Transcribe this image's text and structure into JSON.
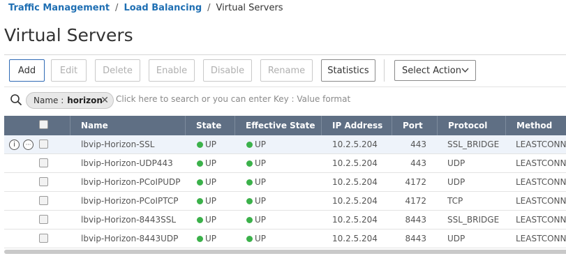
{
  "breadcrumb": {
    "items": [
      "Traffic Management",
      "Load Balancing"
    ],
    "current": "Virtual Servers",
    "separator": "/"
  },
  "page_title": "Virtual Servers",
  "toolbar": {
    "add": "Add",
    "edit": "Edit",
    "delete": "Delete",
    "enable": "Enable",
    "disable": "Disable",
    "rename": "Rename",
    "statistics": "Statistics",
    "select_action": "Select Action"
  },
  "search": {
    "chip_key": "Name :",
    "chip_value": "horizon",
    "placeholder": "Click here to search or you can enter Key : Value format"
  },
  "table": {
    "columns": [
      "Name",
      "State",
      "Effective State",
      "IP Address",
      "Port",
      "Protocol",
      "Method"
    ],
    "rows": [
      {
        "name": "lbvip-Horizon-SSL",
        "state": "UP",
        "effective_state": "UP",
        "ip": "10.2.5.204",
        "port": "443",
        "protocol": "SSL_BRIDGE",
        "method": "LEASTCONNE"
      },
      {
        "name": "lbvip-Horizon-UDP443",
        "state": "UP",
        "effective_state": "UP",
        "ip": "10.2.5.204",
        "port": "443",
        "protocol": "UDP",
        "method": "LEASTCONNE"
      },
      {
        "name": "lbvip-Horizon-PCoIPUDP",
        "state": "UP",
        "effective_state": "UP",
        "ip": "10.2.5.204",
        "port": "4172",
        "protocol": "UDP",
        "method": "LEASTCONNE"
      },
      {
        "name": "lbvip-Horizon-PCoIPTCP",
        "state": "UP",
        "effective_state": "UP",
        "ip": "10.2.5.204",
        "port": "4172",
        "protocol": "TCP",
        "method": "LEASTCONNE"
      },
      {
        "name": "lbvip-Horizon-8443SSL",
        "state": "UP",
        "effective_state": "UP",
        "ip": "10.2.5.204",
        "port": "8443",
        "protocol": "SSL_BRIDGE",
        "method": "LEASTCONNE"
      },
      {
        "name": "lbvip-Horizon-8443UDP",
        "state": "UP",
        "effective_state": "UP",
        "ip": "10.2.5.204",
        "port": "8443",
        "protocol": "UDP",
        "method": "LEASTCONNE"
      }
    ]
  },
  "icons": {
    "info": "i",
    "more": "···",
    "chip_close": "✕"
  },
  "colors": {
    "link": "#1f6fb3",
    "header_bg": "#5f6f84",
    "status_up": "#3bb14a",
    "primary_border": "#2f6ab5"
  }
}
